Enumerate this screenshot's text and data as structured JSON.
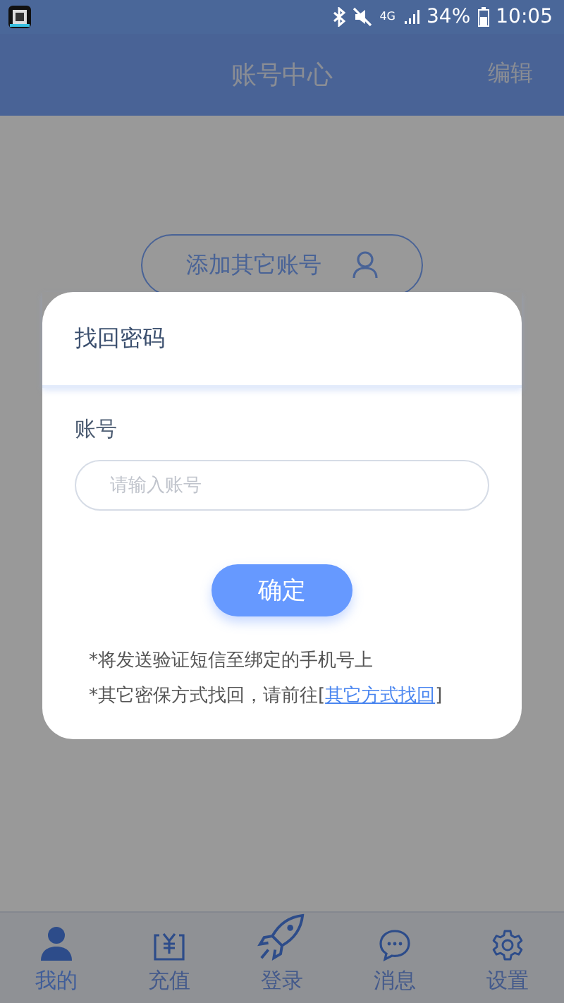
{
  "status_bar": {
    "network": "4G",
    "battery": "34%",
    "time": "10:05"
  },
  "header": {
    "title": "账号中心",
    "action": "编辑"
  },
  "add_account_button": {
    "label": "添加其它账号"
  },
  "dialog": {
    "title": "找回密码",
    "field_label": "账号",
    "placeholder": "请输入账号",
    "confirm": "确定",
    "notes": [
      {
        "text": "*将发送验证短信至绑定的手机号上"
      },
      {
        "text": "*其它密保方式找回，请前往[",
        "link": "其它方式找回",
        "suffix": "]"
      }
    ]
  },
  "tabs": [
    {
      "kind": "person",
      "label": "我的",
      "selected": true
    },
    {
      "kind": "recharge",
      "label": "充值",
      "selected": false
    },
    {
      "kind": "rocket",
      "label": "登录",
      "selected": false
    },
    {
      "kind": "message",
      "label": "消息",
      "selected": false
    },
    {
      "kind": "settings",
      "label": "设置",
      "selected": false
    }
  ]
}
